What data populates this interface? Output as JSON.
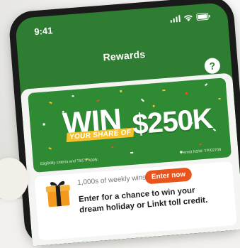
{
  "status_bar": {
    "time": "9:41"
  },
  "header": {
    "title": "Rewards",
    "help_label": "?"
  },
  "promo": {
    "headline": "WIN",
    "subline": "YOUR SHARE OF",
    "amount": "$250K",
    "fine_print_left": "Eligibility criteria and T&C's apply.",
    "fine_print_right": "Permit NSW: TP/02708"
  },
  "weekly": {
    "wins_text": "1,000s of weekly wins",
    "enter_label": "Enter now",
    "description": "Enter for a chance to win your dream holiday or Linkt toll credit."
  },
  "colors": {
    "brand_green": "#2e7d32",
    "accent_orange": "#e8541c",
    "confetti_gold": "#f6c12c"
  },
  "icons": [
    "signal-icon",
    "wifi-icon",
    "battery-icon",
    "help-icon",
    "gift-icon"
  ]
}
